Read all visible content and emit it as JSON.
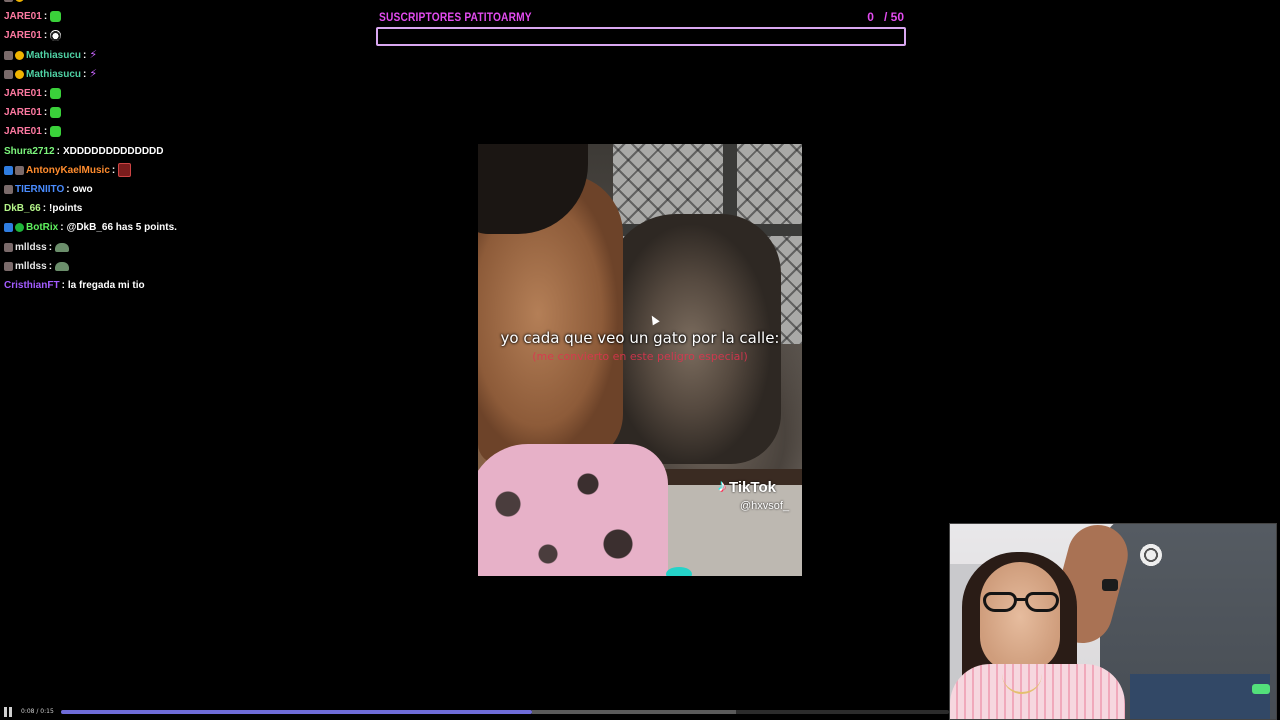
{
  "chat": {
    "lines": [
      {
        "badges": [
          "gray",
          "gold"
        ],
        "user": "Mathiasucu",
        "color": "#4fd1a4",
        "emote": "purple",
        "text": ""
      },
      {
        "badges": [],
        "user": "JARE01",
        "color": "#ff7aa2",
        "emote": "green",
        "text": ""
      },
      {
        "badges": [],
        "user": "JARE01",
        "color": "#ff7aa2",
        "emote": "dog",
        "text": ""
      },
      {
        "badges": [
          "gray",
          "gold"
        ],
        "user": "Mathiasucu",
        "color": "#4fd1a4",
        "emote": "purple",
        "text": ""
      },
      {
        "badges": [
          "gray",
          "gold"
        ],
        "user": "Mathiasucu",
        "color": "#4fd1a4",
        "emote": "purple",
        "text": ""
      },
      {
        "badges": [],
        "user": "JARE01",
        "color": "#ff7aa2",
        "emote": "green",
        "text": ""
      },
      {
        "badges": [],
        "user": "JARE01",
        "color": "#ff7aa2",
        "emote": "green",
        "text": ""
      },
      {
        "badges": [],
        "user": "JARE01",
        "color": "#ff7aa2",
        "emote": "green",
        "text": ""
      },
      {
        "badges": [],
        "user": "Shura2712",
        "color": "#7cf57c",
        "emote": "",
        "text": "XDDDDDDDDDDDDD"
      },
      {
        "badges": [
          "blue",
          "gray"
        ],
        "user": "AntonyKaelMusic",
        "color": "#ff8c2e",
        "emote": "avatar",
        "text": ""
      },
      {
        "badges": [
          "gray"
        ],
        "user": "TIERNIITO",
        "color": "#4a8cff",
        "emote": "",
        "text": "owo"
      },
      {
        "badges": [],
        "user": "DkB_66",
        "color": "#b5f58a",
        "emote": "",
        "text": "!points"
      },
      {
        "badges": [
          "blue",
          "green"
        ],
        "user": "BotRix",
        "color": "#5ef05e",
        "emote": "",
        "text": "@DkB_66 has 5 points."
      },
      {
        "badges": [
          "gray"
        ],
        "user": "mlldss",
        "color": "#e6e6e6",
        "emote": "frog",
        "text": ""
      },
      {
        "badges": [
          "gray"
        ],
        "user": "mlldss",
        "color": "#e6e6e6",
        "emote": "frog",
        "text": ""
      },
      {
        "badges": [],
        "user": "CristhianFT",
        "color": "#a35cff",
        "emote": "",
        "text": "la fregada mi tio"
      }
    ]
  },
  "subgoal": {
    "title": "SUSCRIPTORES PATITOARMY",
    "current": "0",
    "target": "/ 50",
    "progress": 0
  },
  "video": {
    "caption": "yo cada que veo un gato por la calle:",
    "caption_sub": "(me convierto en este peligro especial)",
    "brand": "TikTok",
    "handle": "@hxvsof_"
  },
  "player": {
    "time": "0:08 / 0:15",
    "played_fraction": 0.53,
    "buffered_fraction": 0.76
  },
  "colors": {
    "goal_accent": "#e34cf0",
    "progress_played": "#6e6bd8"
  },
  "icons": {
    "pause": "pause-icon",
    "tiktok": "tiktok-icon"
  }
}
